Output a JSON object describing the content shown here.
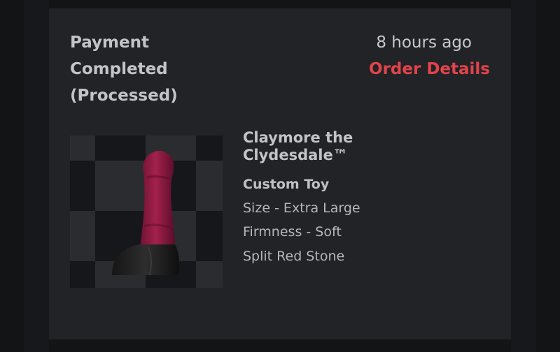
{
  "order": {
    "status": "Payment Completed (Processed)",
    "time_ago": "8 hours ago",
    "details_link": "Order Details"
  },
  "item": {
    "name": "Claymore the Clydesdale™",
    "type": "Custom Toy",
    "options": [
      "Size - Extra Large",
      "Firmness - Soft",
      "Split Red Stone"
    ]
  },
  "colors": {
    "accent": "#e2434b",
    "card_bg": "#212326",
    "page_bg": "#131416",
    "text_primary": "#c3c4c6"
  }
}
